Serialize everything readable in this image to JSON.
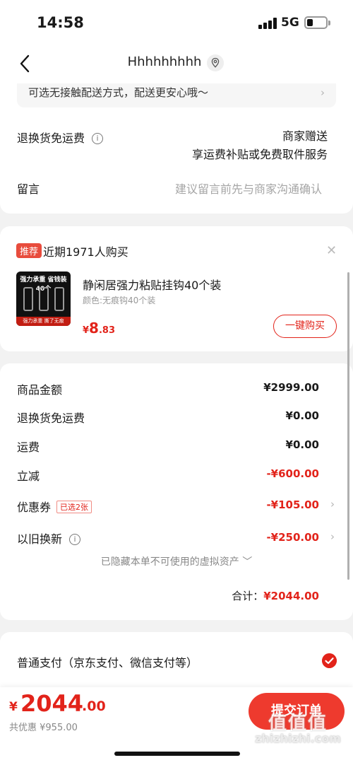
{
  "status_bar": {
    "time": "14:58",
    "network": "5G"
  },
  "nav": {
    "title": "Hhhhhhhhh"
  },
  "delivery": {
    "notice": "可选无接触配送方式，配送更安心哦～",
    "return_label": "退换货免运费",
    "return_value_line1": "商家赠送",
    "return_value_line2": "享运费补贴或免费取件服务",
    "message_label": "留言",
    "message_placeholder": "建议留言前先与商家沟通确认"
  },
  "recommend": {
    "tag": "推荐",
    "headline": "近期1971人购买",
    "product_name": "静闲居强力粘贴挂钩40个装",
    "product_spec": "颜色:无痕钩40个装",
    "image_text_top": "强力承重 省钱装40个",
    "image_text_bottom": "强力承重 撕了无痕",
    "price_symbol": "¥",
    "price_int": "8",
    "price_dec": ".83",
    "buy_label": "一键购买"
  },
  "summary": {
    "rows": [
      {
        "label": "商品金额",
        "value": "¥2999.00"
      },
      {
        "label": "退换货免运费",
        "value": "¥0.00"
      },
      {
        "label": "运费",
        "value": "¥0.00"
      },
      {
        "label": "立减",
        "value": "-¥600.00"
      },
      {
        "label": "优惠券",
        "badge": "已选2张",
        "value": "-¥105.00"
      },
      {
        "label": "以旧换新",
        "value": "-¥250.00"
      }
    ],
    "hidden_assets": "已隐藏本单不可使用的虚拟资产 ﹀",
    "total_label": "合计：",
    "total_value": "¥2044.00"
  },
  "payment": {
    "option": "普通支付（京东支付、微信支付等）"
  },
  "bottom": {
    "price_symbol": "¥",
    "price_int": "2044",
    "price_dec": ".00",
    "saved": "共优惠 ¥955.00",
    "submit_label": "提交订单",
    "watermark_cn": "值值值",
    "watermark_en": "zhizhizhi.com"
  },
  "colors": {
    "accent": "#e2231a",
    "background": "#f2f2f2"
  }
}
